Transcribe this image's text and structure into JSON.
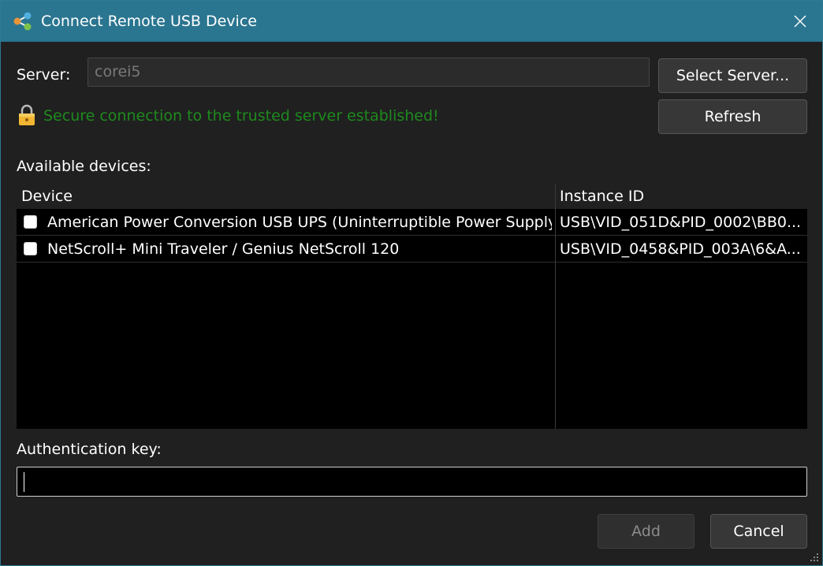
{
  "window": {
    "title": "Connect Remote USB Device",
    "accent_color": "#2a7590",
    "app_icon": "share-nodes-icon",
    "close_icon": "close-icon"
  },
  "server": {
    "label": "Server:",
    "value": "corei5",
    "select_button": "Select Server...",
    "refresh_button": "Refresh"
  },
  "status": {
    "icon": "lock-icon",
    "text": "Secure connection to the trusted server established!",
    "color": "#1e8a1e"
  },
  "devices": {
    "label": "Available devices:",
    "columns": [
      "Device",
      "Instance ID"
    ],
    "rows": [
      {
        "checked": false,
        "device": "American Power Conversion USB UPS (Uninterruptible Power Supply)",
        "instance_id": "USB\\VID_051D&PID_0002\\BB0..."
      },
      {
        "checked": false,
        "device": "NetScroll+ Mini Traveler / Genius NetScroll 120",
        "instance_id": "USB\\VID_0458&PID_003A\\6&A..."
      }
    ]
  },
  "auth": {
    "label": "Authentication key:",
    "value": ""
  },
  "actions": {
    "add_button": "Add",
    "add_enabled": false,
    "cancel_button": "Cancel"
  }
}
